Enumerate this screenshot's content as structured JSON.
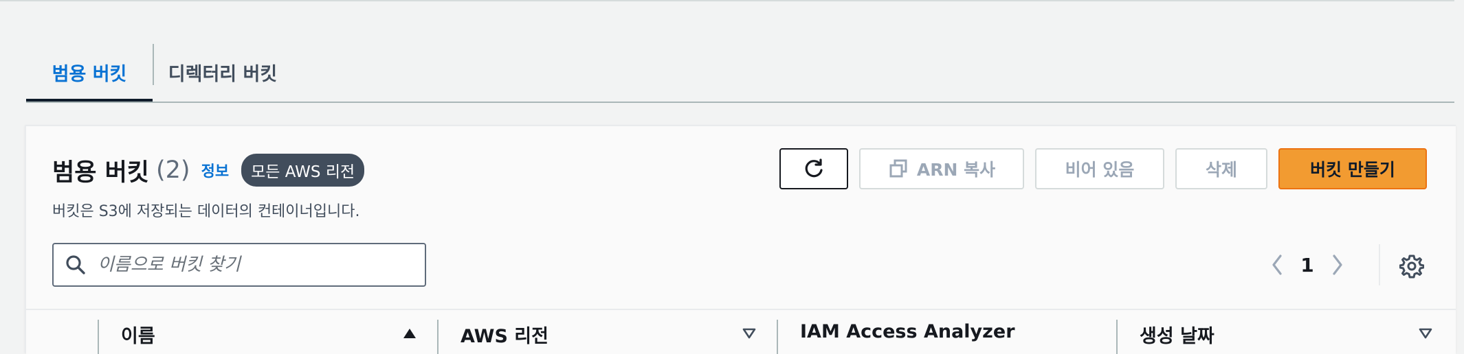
{
  "tabs": [
    {
      "label": "범용 버킷",
      "active": true
    },
    {
      "label": "디렉터리 버킷",
      "active": false
    }
  ],
  "panel": {
    "title": "범용 버킷",
    "count": "(2)",
    "info_link": "정보",
    "region_badge": "모든 AWS 리전",
    "description": "버킷은 S3에 저장되는 데이터의 컨테이너입니다."
  },
  "actions": {
    "refresh_icon": "refresh-icon",
    "copy_arn_label": "ARN 복사",
    "copy_icon": "copy-icon",
    "empty_label": "비어 있음",
    "delete_label": "삭제",
    "create_label": "버킷 만들기"
  },
  "search": {
    "placeholder": "이름으로 버킷 찾기",
    "value": ""
  },
  "pagination": {
    "current_page": "1"
  },
  "table": {
    "columns": [
      {
        "label": "이름",
        "sort": "ascending"
      },
      {
        "label": "AWS 리전",
        "sort": "none"
      },
      {
        "label": "IAM Access Analyzer",
        "sort": "none"
      },
      {
        "label": "생성 날짜",
        "sort": "none"
      }
    ]
  },
  "colors": {
    "accent": "#0972d3",
    "primary_button": "#f29b31",
    "badge": "#414d5c"
  }
}
